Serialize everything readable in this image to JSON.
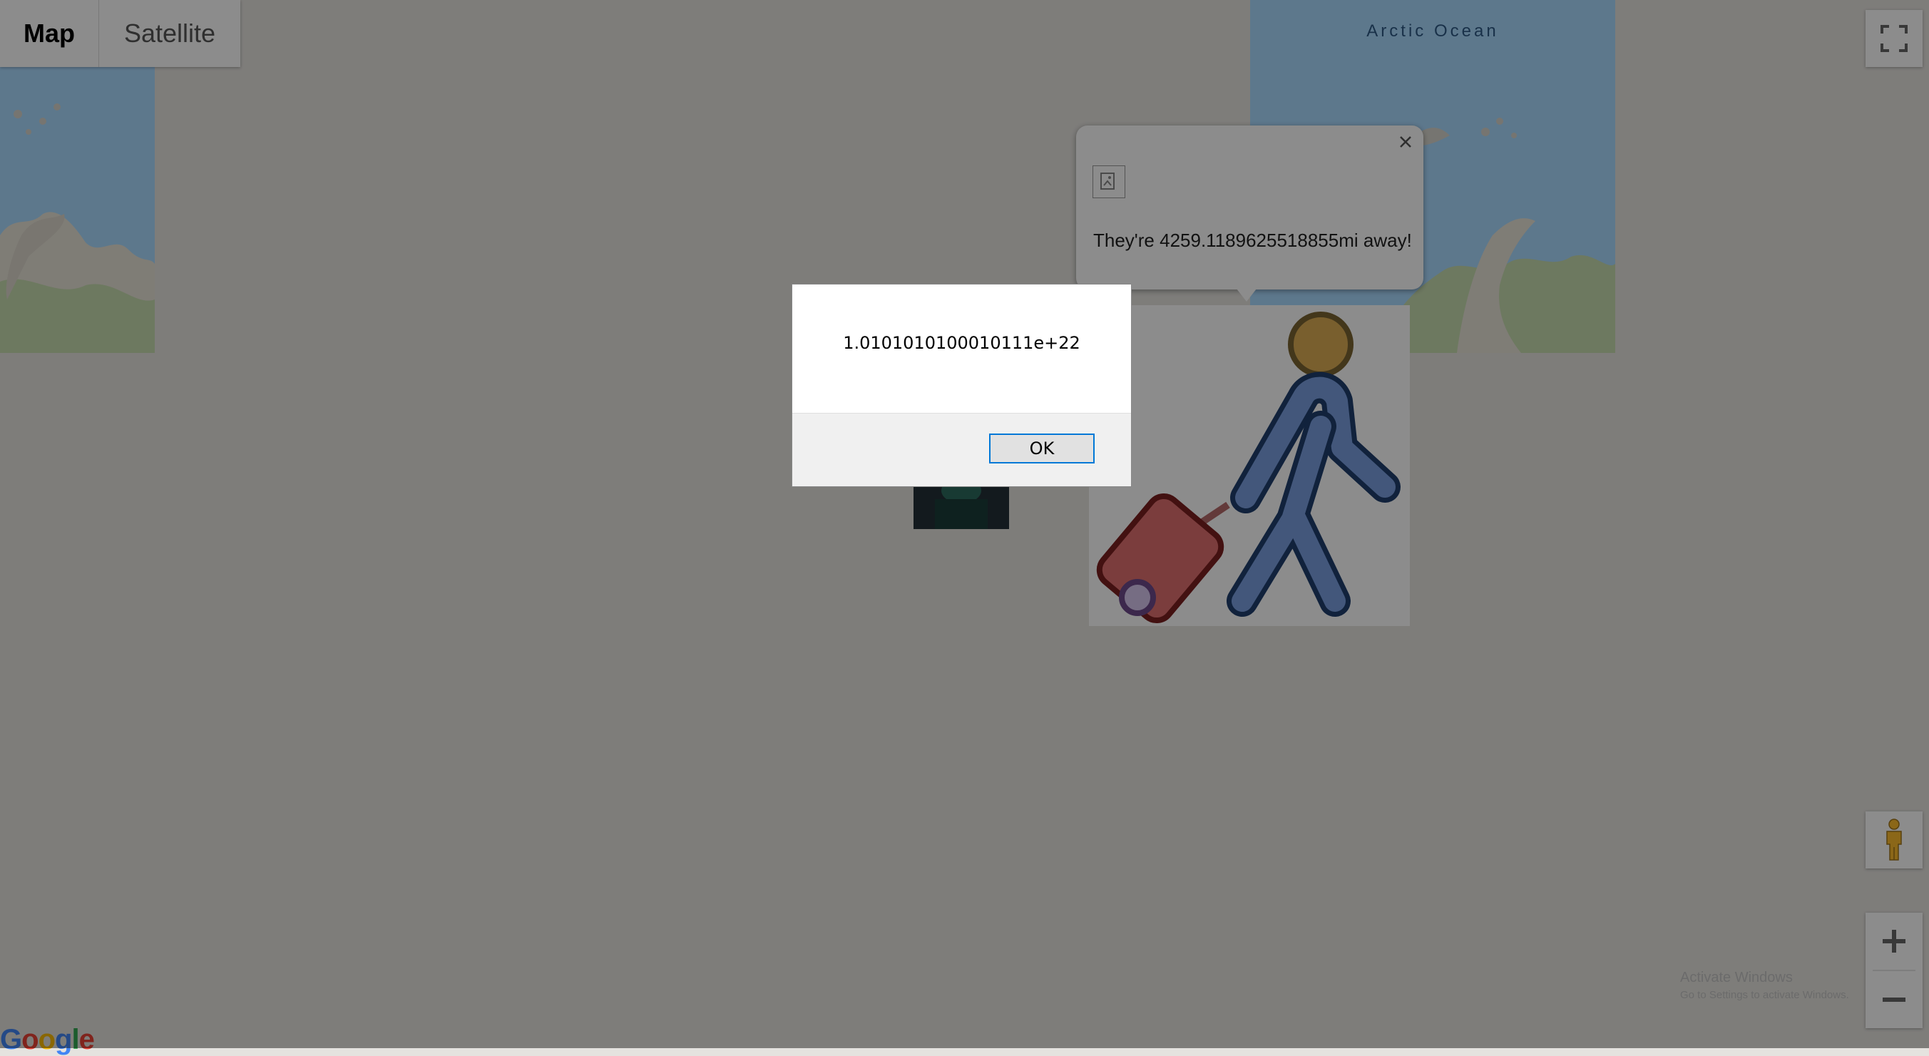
{
  "map": {
    "type_control": {
      "map_label": "Map",
      "satellite_label": "Satellite",
      "selected": "Map"
    },
    "ocean_label": "Arctic Ocean",
    "google_logo": [
      "G",
      "o",
      "o",
      "g",
      "l",
      "e"
    ],
    "colors": {
      "water": "#aadaff",
      "land": "#e5e3df"
    }
  },
  "controls": {
    "fullscreen_icon": "fullscreen-icon",
    "pegman_icon": "pegman-icon",
    "zoom_in_icon": "plus-icon",
    "zoom_out_icon": "minus-icon"
  },
  "info_window": {
    "close_icon": "close-icon",
    "image_icon": "broken-image-icon",
    "text": "They're 4259.1189625518855mi away!"
  },
  "alert": {
    "message": "1.0101010100010111e+22",
    "ok_label": "OK"
  },
  "watermark": {
    "line1": "Activate Windows",
    "line2": "Go to Settings to activate Windows."
  }
}
